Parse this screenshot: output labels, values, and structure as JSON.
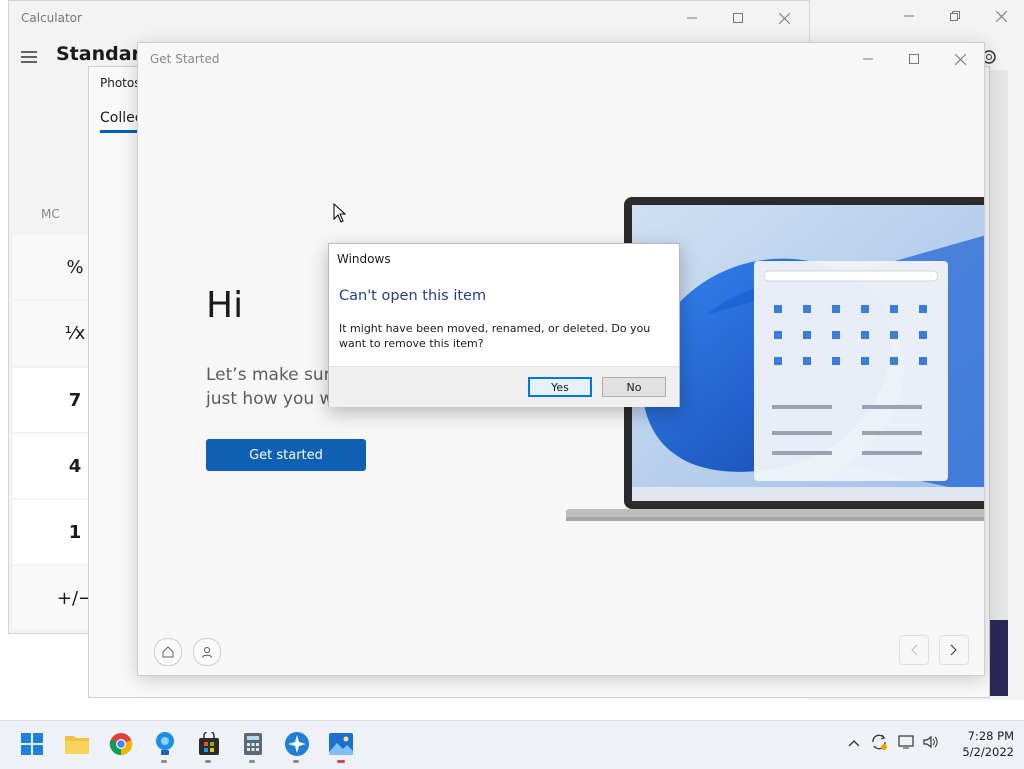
{
  "calculator": {
    "title": "Calculator",
    "mode": "Standard",
    "memory_label": "MC",
    "keys": [
      "%",
      "¹⁄x",
      "7",
      "4",
      "1",
      "+/−"
    ]
  },
  "photos": {
    "title": "Photos",
    "tab": "Collec"
  },
  "get_started": {
    "title": "Get Started",
    "greeting": "Hi",
    "intro_line1": "Let’s make sure",
    "intro_line2": "just how you wa",
    "button": "Get started"
  },
  "dialog": {
    "title": "Windows",
    "heading": "Can't open this item",
    "message": "It might have been moved, renamed, or deleted. Do you want to remove this item?",
    "yes_label": "Yes",
    "no_label": "No"
  },
  "taskbar": {
    "icons": [
      "start-icon",
      "file-explorer-icon",
      "chrome-icon",
      "tips-icon",
      "store-icon",
      "calculator-icon",
      "get-started-icon",
      "photos-icon"
    ],
    "time": "7:28 PM",
    "date": "5/2/2022"
  },
  "colors": {
    "accent": "#0f5fb3",
    "dialog_heading": "#1f3f8f",
    "taskbar": "#eef1f6"
  }
}
